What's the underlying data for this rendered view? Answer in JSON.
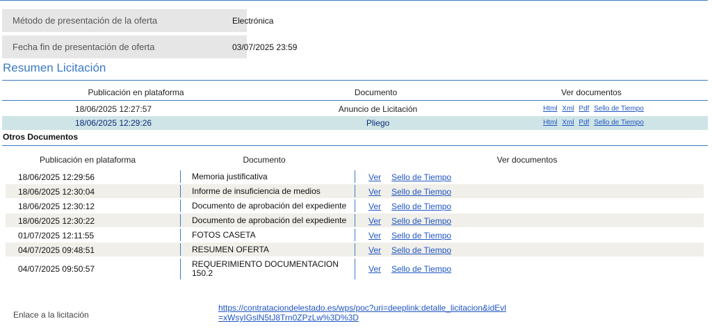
{
  "details": [
    {
      "label": "Método de presentación de la oferta",
      "value": "Electrónica"
    },
    {
      "label": "Fecha fin de presentación de oferta",
      "value": "03/07/2025 23:59"
    }
  ],
  "resumen": {
    "title": "Resumen Licitación",
    "headers": [
      "Publicación en plataforma",
      "Documento",
      "Ver documentos"
    ],
    "rows": [
      {
        "date": "18/06/2025 12:27:57",
        "doc": "Anuncio de Licitación",
        "selected": false
      },
      {
        "date": "18/06/2025 12:29:26",
        "doc": "Pliego",
        "selected": true
      }
    ],
    "links": [
      "Html",
      "Xml",
      "Pdf",
      "Sello de Tiempo"
    ]
  },
  "otros": {
    "title": "Otros Documentos",
    "headers": [
      "Publicación en plataforma",
      "Documento",
      "Ver documentos"
    ],
    "ver_label": "Ver",
    "sello_label": "Sello de Tiempo",
    "rows": [
      {
        "date": "18/06/2025 12:29:56",
        "doc": "Memoria justificativa"
      },
      {
        "date": "18/06/2025 12:30:04",
        "doc": "Informe de insuficiencia de medios"
      },
      {
        "date": "18/06/2025 12:30:12",
        "doc": "Documento de aprobación del expediente"
      },
      {
        "date": "18/06/2025 12:30:22",
        "doc": "Documento de aprobación del expediente"
      },
      {
        "date": "01/07/2025 12:11:55",
        "doc": "FOTOS CASETA"
      },
      {
        "date": "04/07/2025 09:48:51",
        "doc": "RESUMEN OFERTA"
      },
      {
        "date": "04/07/2025 09:50:57",
        "doc": "REQUERIMIENTO DOCUMENTACION 150.2"
      }
    ]
  },
  "enlace": {
    "label": "Enlace a la licitación",
    "url": "https://contrataciondelestado.es/wps/poc?uri=deeplink:detalle_licitacion&idEvl=xWsyIGslN5tJ8Trn0ZPzLw%3D%3D"
  },
  "colors": {
    "accent": "#3b79c2",
    "selected_row": "#cfe4e6",
    "alt_row": "#f0efe9",
    "link": "#1f55c4"
  }
}
